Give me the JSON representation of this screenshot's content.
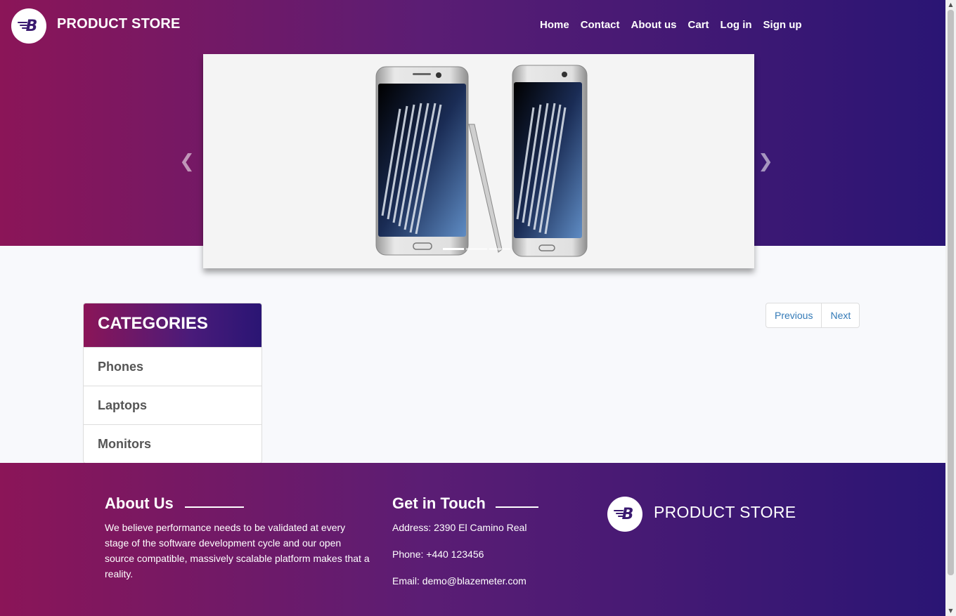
{
  "header": {
    "brand": "PRODUCT STORE",
    "logo_icon": "blazemeter-b-logo",
    "nav": [
      {
        "label": "Home"
      },
      {
        "label": "Contact"
      },
      {
        "label": "About us"
      },
      {
        "label": "Cart"
      },
      {
        "label": "Log in"
      },
      {
        "label": "Sign up"
      }
    ]
  },
  "carousel": {
    "image": "samsung-galaxy-note-phones",
    "prev_icon": "chevron-left-icon",
    "next_icon": "chevron-right-icon",
    "slide_count": 3,
    "active_slide": 1
  },
  "categories": {
    "title": "CATEGORIES",
    "items": [
      {
        "label": "Phones"
      },
      {
        "label": "Laptops"
      },
      {
        "label": "Monitors"
      }
    ]
  },
  "pagination": {
    "previous_label": "Previous",
    "next_label": "Next"
  },
  "footer": {
    "about": {
      "title": "About Us",
      "text": "We believe performance needs to be validated at every stage of the software development cycle and our open source compatible, massively scalable platform makes that a reality."
    },
    "contact": {
      "title": "Get in Touch",
      "address": "Address: 2390 El Camino Real",
      "phone": "Phone: +440 123456",
      "email": "Email: demo@blazemeter.com"
    },
    "brand": "PRODUCT STORE"
  },
  "colors": {
    "gradient_start": "#8b1558",
    "gradient_end": "#2a1574",
    "link": "#337ab7"
  }
}
